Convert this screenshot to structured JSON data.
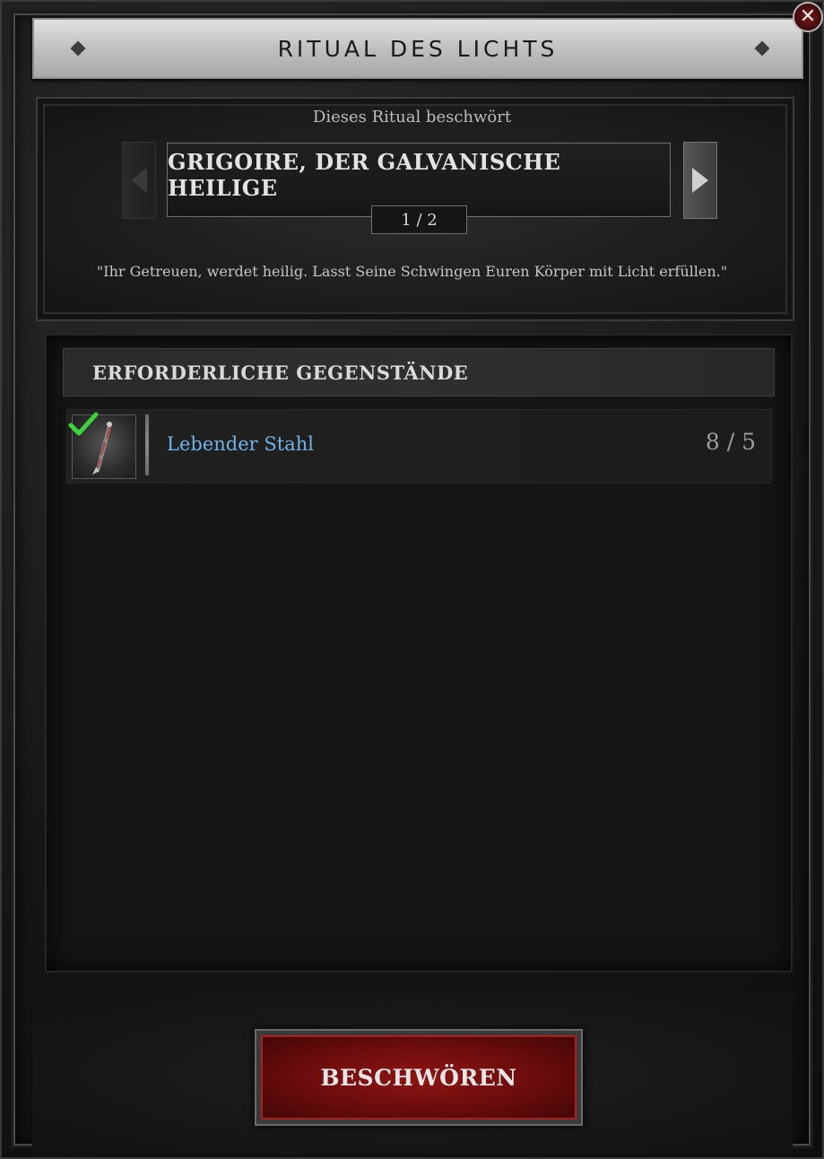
{
  "window": {
    "title": "RITUAL DES LICHTS",
    "close_icon": "x"
  },
  "ritual": {
    "summons_label": "Dieses Ritual beschwört",
    "boss_name": "GRIGOIRE, DER GALVANISCHE HEILIGE",
    "page": "1 / 2",
    "quote": "\"Ihr Getreuen, werdet heilig. Lasst Seine Schwingen Euren Körper mit Licht erfüllen.\""
  },
  "requirements": {
    "header": "ERFORDERLICHE GEGENSTÄNDE",
    "items": [
      {
        "name": "Lebender Stahl",
        "count": "8 / 5",
        "fulfilled": true,
        "name_color": "#6fb3e8",
        "icon": "living-steel-icon"
      }
    ]
  },
  "actions": {
    "summon_label": "BESCHWÖREN",
    "accent_color": "#8e1414"
  }
}
